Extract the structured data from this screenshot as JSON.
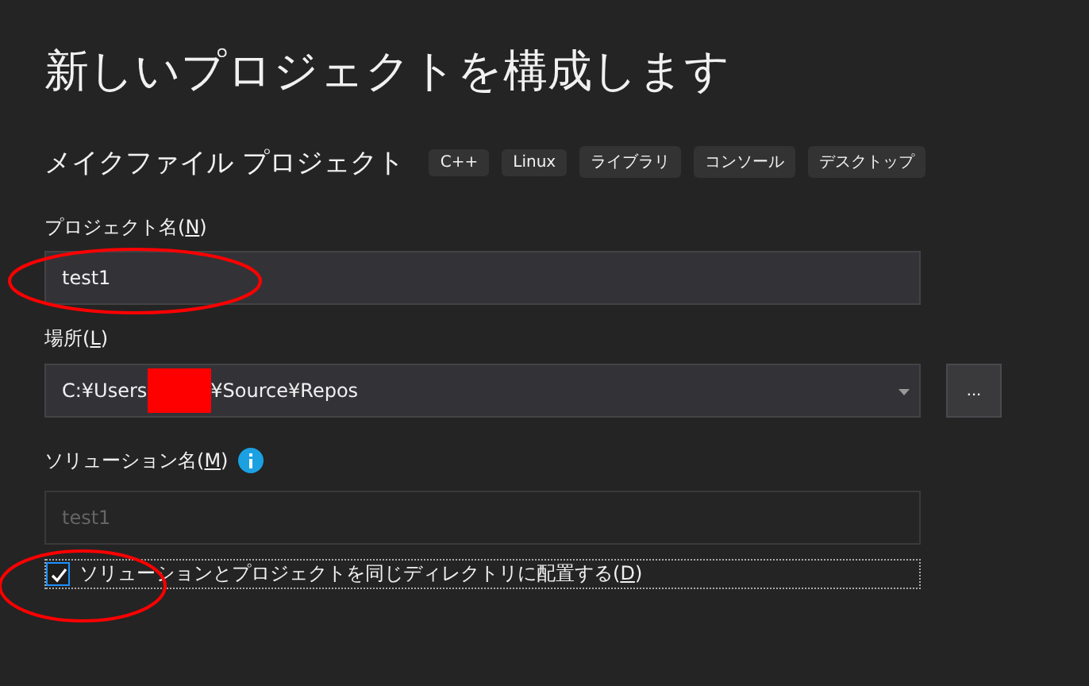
{
  "title": "新しいプロジェクトを構成します",
  "template": {
    "name": "メイクファイル プロジェクト",
    "tags": [
      "C++",
      "Linux",
      "ライブラリ",
      "コンソール",
      "デスクトップ"
    ]
  },
  "project_name": {
    "label": "プロジェクト名(",
    "access_key": "N",
    "label_end": ")",
    "value": "test1"
  },
  "location": {
    "label": "場所(",
    "access_key": "L",
    "label_end": ")",
    "value_start": "C:¥Users",
    "value_end": "¥Source¥Repos",
    "browse": "..."
  },
  "solution_name": {
    "label": "ソリューション名(",
    "access_key": "M",
    "label_end": ")",
    "value": "test1",
    "disabled": true
  },
  "same_directory": {
    "label": "ソリューションとプロジェクトを同じディレクトリに配置する(",
    "access_key": "D",
    "label_end": ")",
    "checked": true
  }
}
